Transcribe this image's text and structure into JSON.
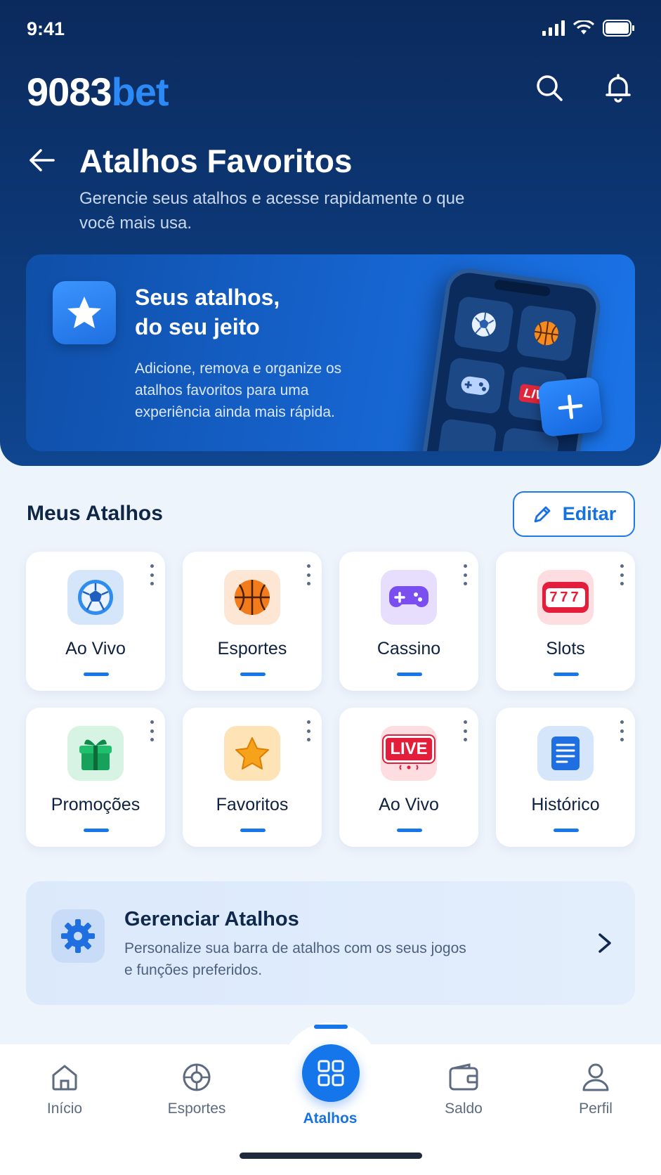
{
  "status_bar": {
    "time": "9:41"
  },
  "header": {
    "logo_main": "9083",
    "logo_accent": "bet",
    "title": "Atalhos Favoritos",
    "subtitle": "Gerencie seus atalhos e acesse rapidamente o que você mais usa."
  },
  "banner": {
    "title_line1": "Seus atalhos,",
    "title_line2": "do seu jeito",
    "text": "Adicione, remova e organize os atalhos favoritos para uma experiência ainda mais rápida.",
    "phone_live_badge": "LIVE"
  },
  "section": {
    "title": "Meus Atalhos",
    "edit_label": "Editar"
  },
  "shortcuts": [
    {
      "label": "Ao Vivo",
      "icon": "soccer-ball-icon"
    },
    {
      "label": "Esportes",
      "icon": "basketball-icon"
    },
    {
      "label": "Cassino",
      "icon": "gamepad-icon"
    },
    {
      "label": "Slots",
      "icon": "slot-machine-icon",
      "icon_text": "777"
    },
    {
      "label": "Promoções",
      "icon": "gift-icon"
    },
    {
      "label": "Favoritos",
      "icon": "star-icon"
    },
    {
      "label": "Ao Vivo",
      "icon": "live-tv-icon",
      "icon_text": "LIVE"
    },
    {
      "label": "Histórico",
      "icon": "document-icon"
    }
  ],
  "manage": {
    "title": "Gerenciar Atalhos",
    "description": "Personalize sua barra de atalhos com os seus jogos e funções preferidos."
  },
  "nav": {
    "items": [
      {
        "label": "Início",
        "icon": "home-icon"
      },
      {
        "label": "Esportes",
        "icon": "ball-icon"
      },
      {
        "label": "Atalhos",
        "icon": "grid-icon",
        "active": true
      },
      {
        "label": "Saldo",
        "icon": "wallet-icon"
      },
      {
        "label": "Perfil",
        "icon": "user-icon"
      }
    ]
  },
  "colors": {
    "header_bg": "#0b2a5c",
    "accent": "#1776ea",
    "page_bg": "#eef4fc"
  }
}
